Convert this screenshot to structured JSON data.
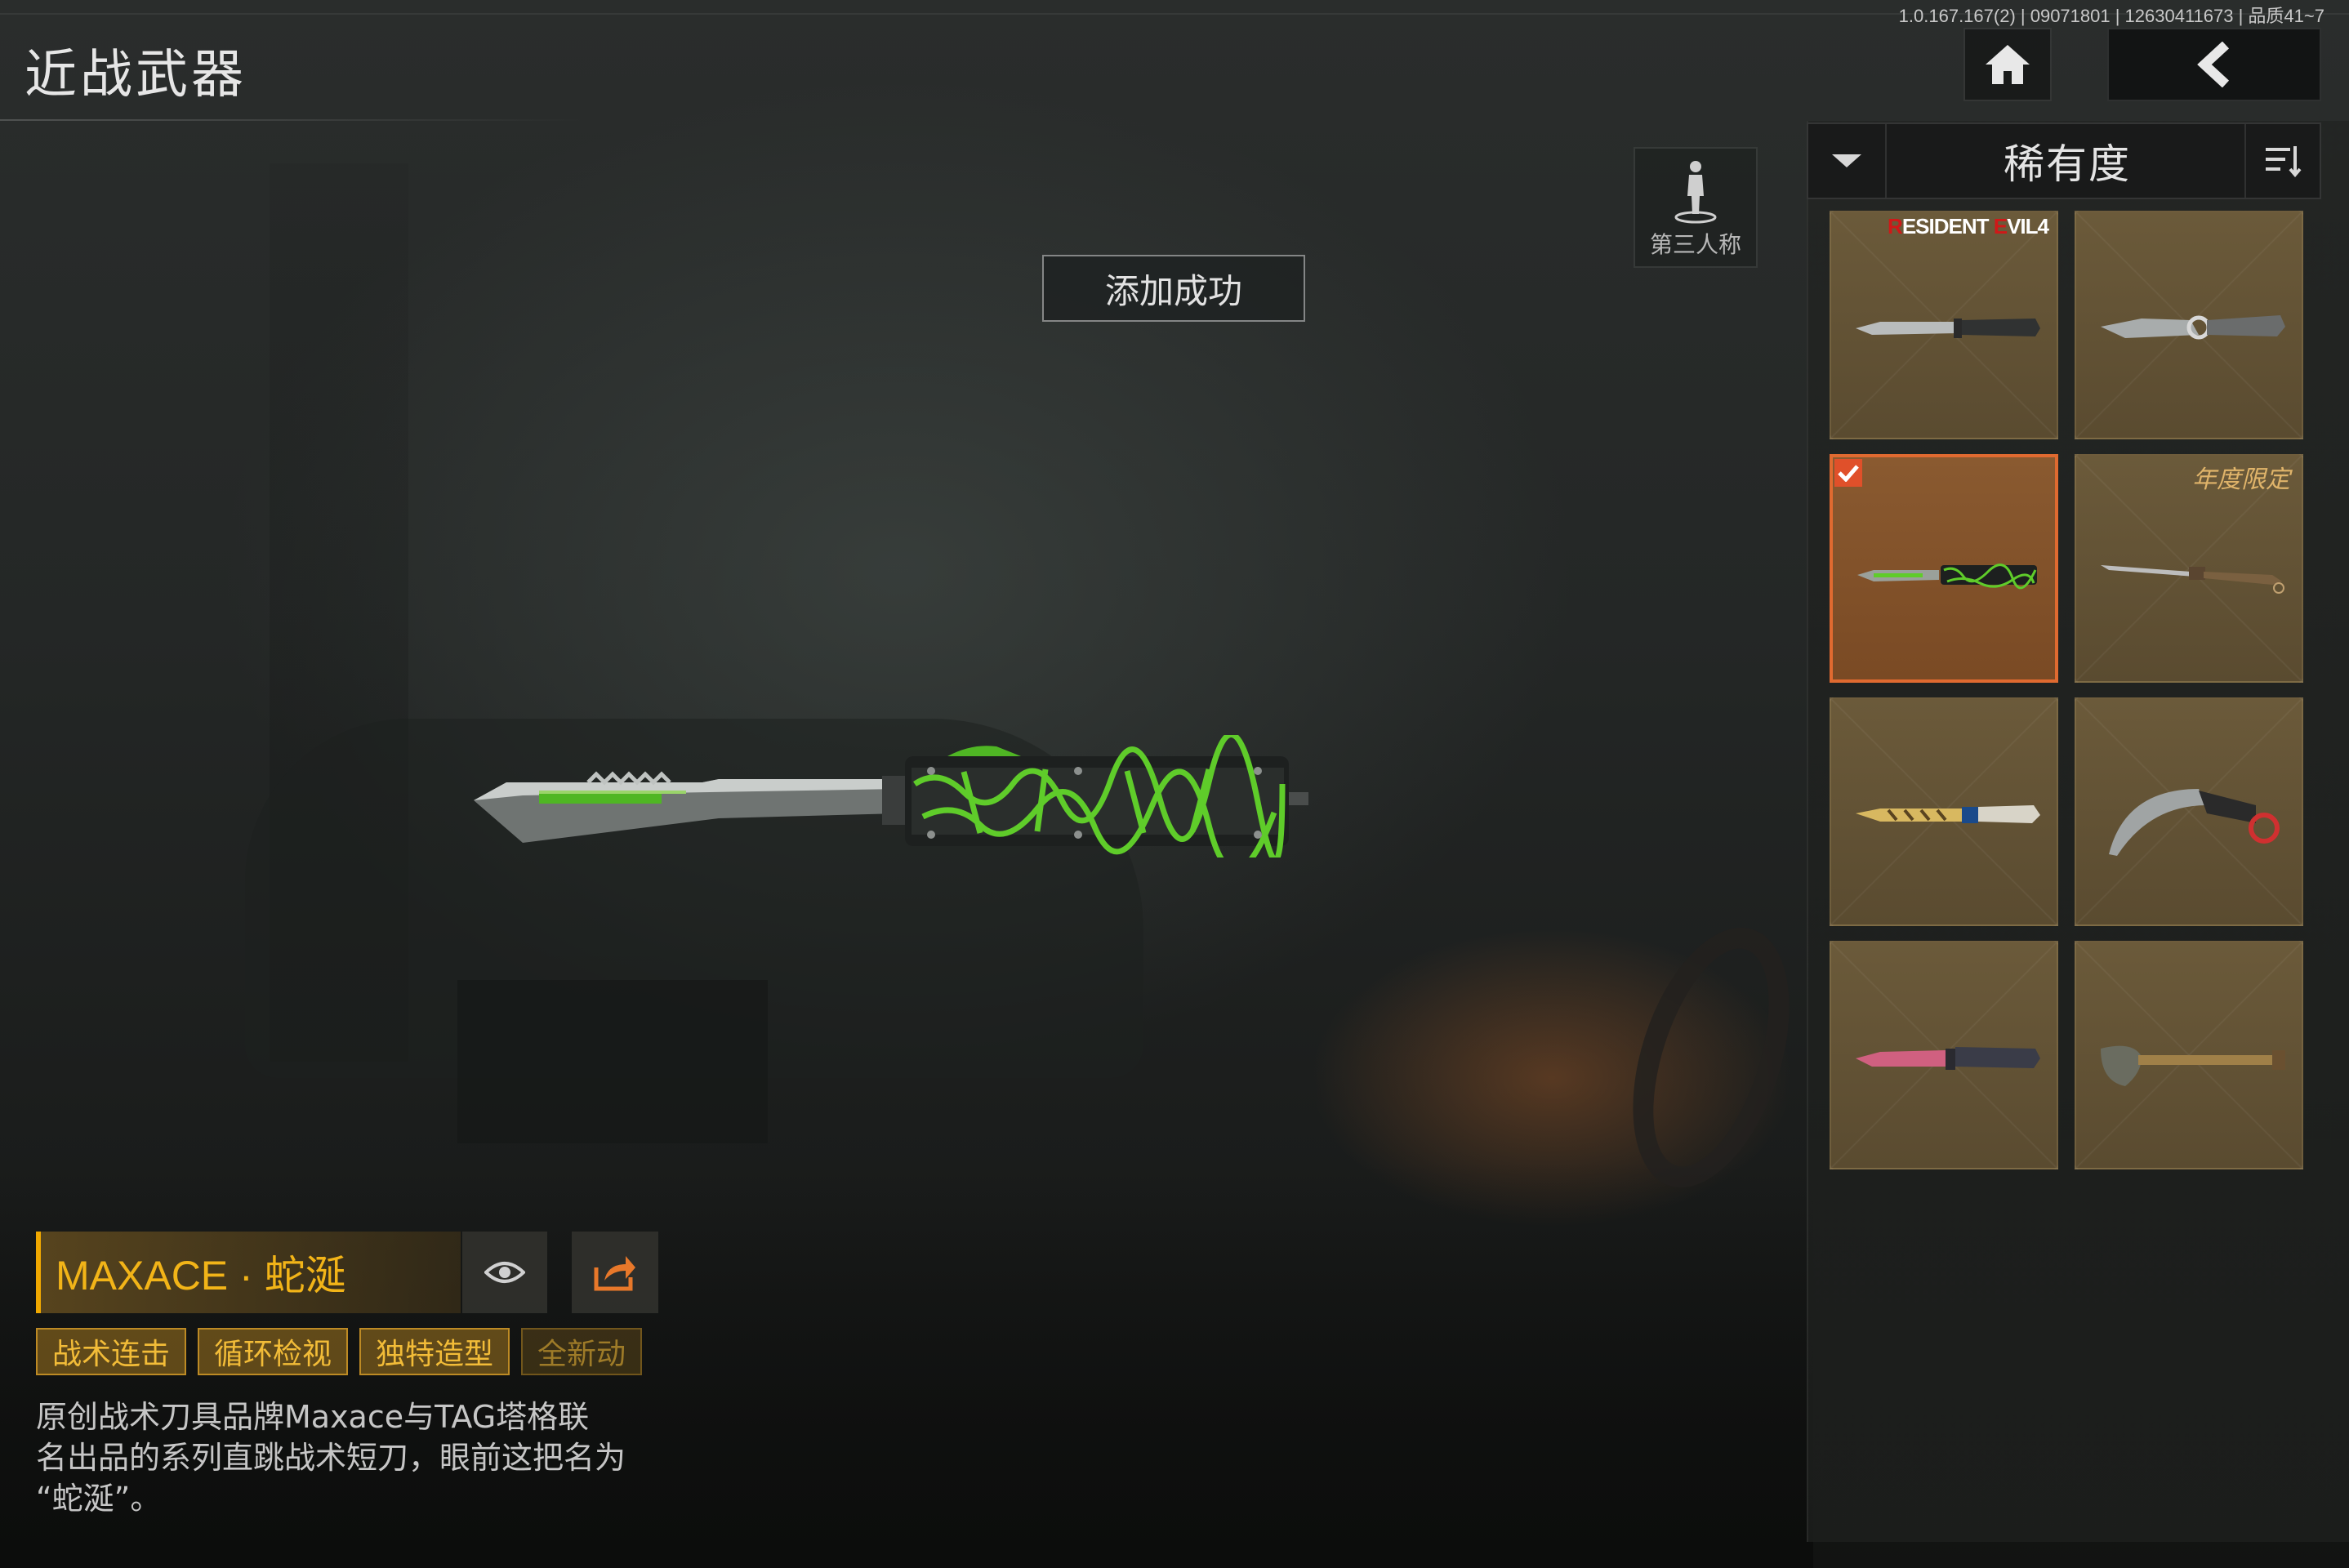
{
  "header": {
    "title": "近战武器",
    "build_info": "1.0.167.167(2) | 09071801 | 12630411673 | 品质41~7"
  },
  "nav": {
    "home_icon": "home-icon",
    "back_icon": "back-arrow-icon"
  },
  "view_toggle": {
    "label": "第三人称",
    "icon": "third-person-figure-icon"
  },
  "toast": {
    "text": "添加成功"
  },
  "sort": {
    "label": "稀有度",
    "dropdown_icon": "chevron-down-icon",
    "order_icon": "sort-order-icon"
  },
  "inventory": [
    {
      "name": "combat-knife-gray",
      "badge": "RESIDENT EVIL4",
      "badge_parts": [
        "R",
        "ESIDENT ",
        "E",
        "VIL4"
      ],
      "selected": false
    },
    {
      "name": "tactical-knife-silver",
      "badge": "",
      "selected": false
    },
    {
      "name": "maxace-knife-green",
      "badge": "",
      "selected": true
    },
    {
      "name": "long-blade-knife",
      "badge": "年度限定",
      "selected": false
    },
    {
      "name": "butterfly-knife-gold",
      "badge": "",
      "selected": false
    },
    {
      "name": "karambit-knife",
      "badge": "",
      "selected": false
    },
    {
      "name": "pink-combat-knife",
      "badge": "",
      "selected": false
    },
    {
      "name": "shovel",
      "badge": "",
      "selected": false
    }
  ],
  "item": {
    "name": "MAXACE · 蛇涎",
    "preview_icon": "eye-icon",
    "share_icon": "share-icon",
    "tags": [
      "战术连击",
      "循环检视",
      "独特造型",
      "全新动"
    ],
    "description_lines": [
      "原创战术刀具品牌Maxace与TAG塔格联",
      "名出品的系列直跳战术短刀，眼前这把名为",
      "“蛇涎”。"
    ]
  },
  "colors": {
    "accent": "#f0a800",
    "selected_border": "#e06a30",
    "card_bg": "#6b5a3a",
    "knife_green": "#5fcc2a"
  }
}
